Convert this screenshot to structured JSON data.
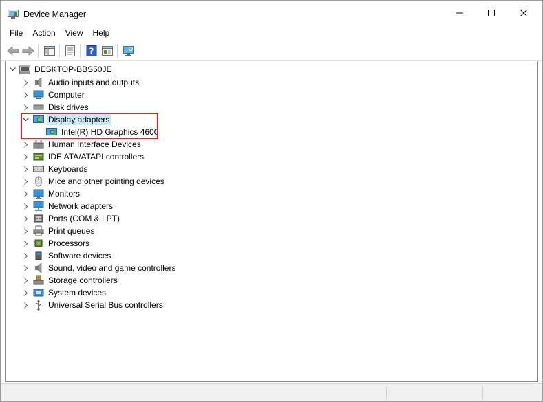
{
  "window": {
    "title": "Device Manager",
    "minimize_glyph": "—",
    "maximize_glyph": "☐",
    "close_glyph": "✕"
  },
  "menu": [
    "File",
    "Action",
    "View",
    "Help"
  ],
  "toolbar": {
    "buttons": [
      "back-arrow-icon",
      "forward-arrow-icon",
      "console-tree-icon",
      "properties-icon",
      "help-icon",
      "action-pane-icon",
      "monitor-scan-icon"
    ]
  },
  "tree": {
    "root": "DESKTOP-BBS50JE",
    "categories": [
      {
        "label": "Audio inputs and outputs",
        "icon": "speaker-icon",
        "expanded": false
      },
      {
        "label": "Computer",
        "icon": "computer-icon",
        "expanded": false
      },
      {
        "label": "Disk drives",
        "icon": "disk-drive-icon",
        "expanded": false
      },
      {
        "label": "Display adapters",
        "icon": "display-adapter-icon",
        "expanded": true,
        "selected": true,
        "children": [
          {
            "label": "Intel(R) HD Graphics 4600",
            "icon": "display-adapter-icon"
          }
        ]
      },
      {
        "label": "Human Interface Devices",
        "icon": "hid-icon",
        "expanded": false
      },
      {
        "label": "IDE ATA/ATAPI controllers",
        "icon": "ide-controller-icon",
        "expanded": false
      },
      {
        "label": "Keyboards",
        "icon": "keyboard-icon",
        "expanded": false
      },
      {
        "label": "Mice and other pointing devices",
        "icon": "mouse-icon",
        "expanded": false
      },
      {
        "label": "Monitors",
        "icon": "monitor-icon",
        "expanded": false
      },
      {
        "label": "Network adapters",
        "icon": "network-adapter-icon",
        "expanded": false
      },
      {
        "label": "Ports (COM & LPT)",
        "icon": "port-icon",
        "expanded": false
      },
      {
        "label": "Print queues",
        "icon": "printer-icon",
        "expanded": false
      },
      {
        "label": "Processors",
        "icon": "processor-icon",
        "expanded": false
      },
      {
        "label": "Software devices",
        "icon": "software-device-icon",
        "expanded": false
      },
      {
        "label": "Sound, video and game controllers",
        "icon": "sound-icon",
        "expanded": false
      },
      {
        "label": "Storage controllers",
        "icon": "storage-controller-icon",
        "expanded": false
      },
      {
        "label": "System devices",
        "icon": "system-device-icon",
        "expanded": false
      },
      {
        "label": "Universal Serial Bus controllers",
        "icon": "usb-icon",
        "expanded": false
      }
    ]
  },
  "colors": {
    "selection": "#cce8ff",
    "highlight_box": "#e0262c"
  }
}
